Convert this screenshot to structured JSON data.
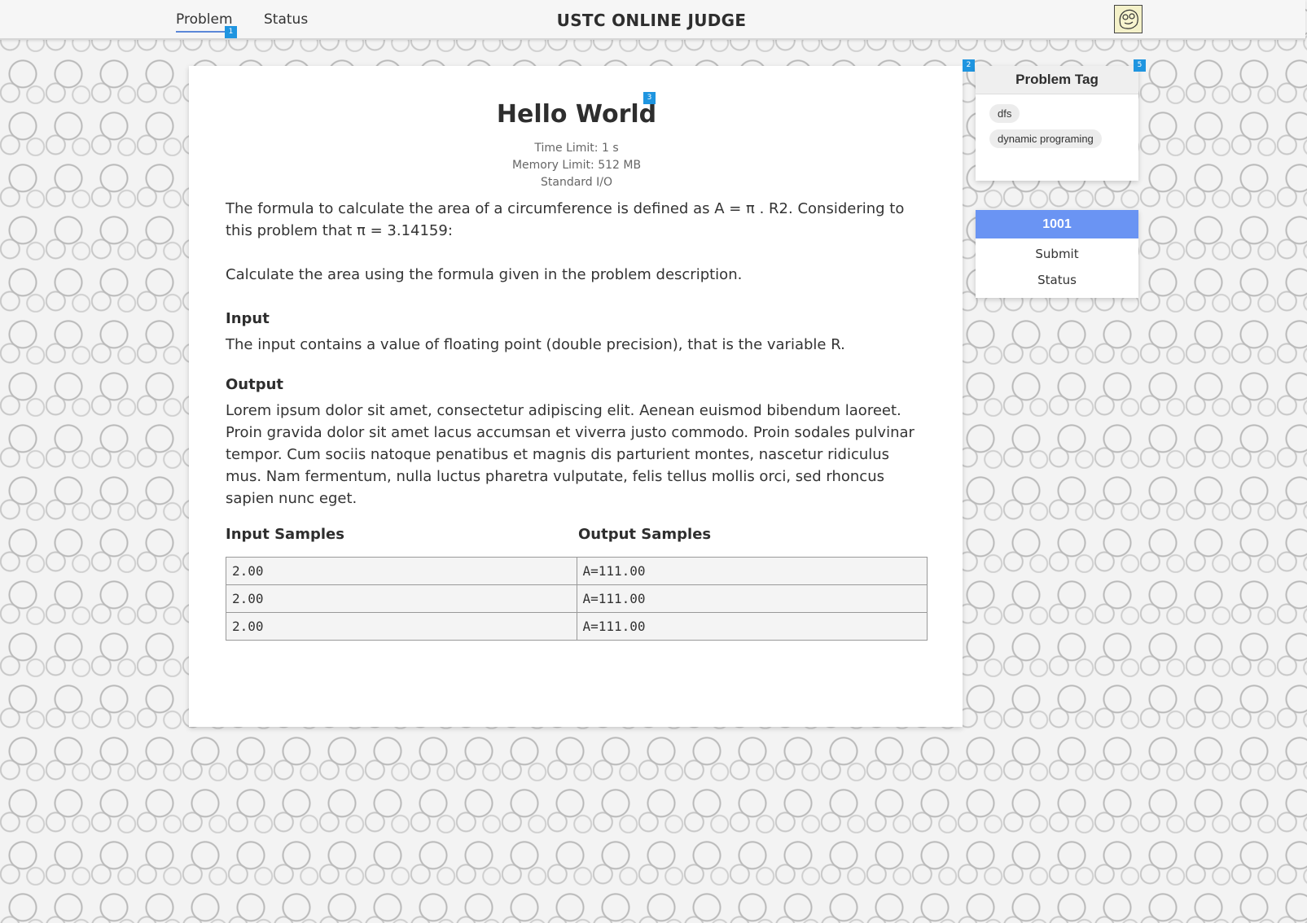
{
  "header": {
    "nav": [
      {
        "label": "Problem",
        "active": true
      },
      {
        "label": "Status",
        "active": false
      }
    ],
    "title": "USTC ONLINE JUDGE",
    "avatar_icon": "user-avatar-icon"
  },
  "markers": [
    "1",
    "2",
    "3",
    "5"
  ],
  "problem": {
    "title": "Hello World",
    "time_limit": "Time Limit: 1 s",
    "memory_limit": "Memory Limit: 512 MB",
    "io": "Standard I/O",
    "description": [
      "The formula to calculate the area of a circumference is defined as A = π . R2. Considering to this problem that π = 3.14159:",
      "Calculate the area using the formula given in the problem description."
    ],
    "input_heading": "Input",
    "input_text": "The input contains a value of floating point (double precision), that is the variable R.",
    "output_heading": "Output",
    "output_text": "Lorem ipsum dolor sit amet, consectetur adipiscing elit. Aenean euismod bibendum laoreet. Proin gravida dolor sit amet lacus accumsan et viverra justo commodo. Proin sodales pulvinar tempor. Cum sociis natoque penatibus et magnis dis parturient montes, nascetur ridiculus mus. Nam fermentum, nulla luctus pharetra vulputate, felis tellus mollis orci, sed rhoncus sapien nunc eget.",
    "samples": {
      "input_heading": "Input Samples",
      "output_heading": "Output Samples",
      "rows": [
        {
          "input": "2.00",
          "output": "A=111.00"
        },
        {
          "input": "2.00",
          "output": "A=111.00"
        },
        {
          "input": "2.00",
          "output": "A=111.00"
        }
      ]
    }
  },
  "tag_panel": {
    "title": "Problem Tag",
    "tags": [
      "dfs",
      "dynamic programing"
    ]
  },
  "action_panel": {
    "problem_id": "1001",
    "submit_label": "Submit",
    "status_label": "Status"
  },
  "colors": {
    "accent": "#6a94f3",
    "marker": "#1f95e0",
    "nav_underline": "#5b87d8"
  }
}
